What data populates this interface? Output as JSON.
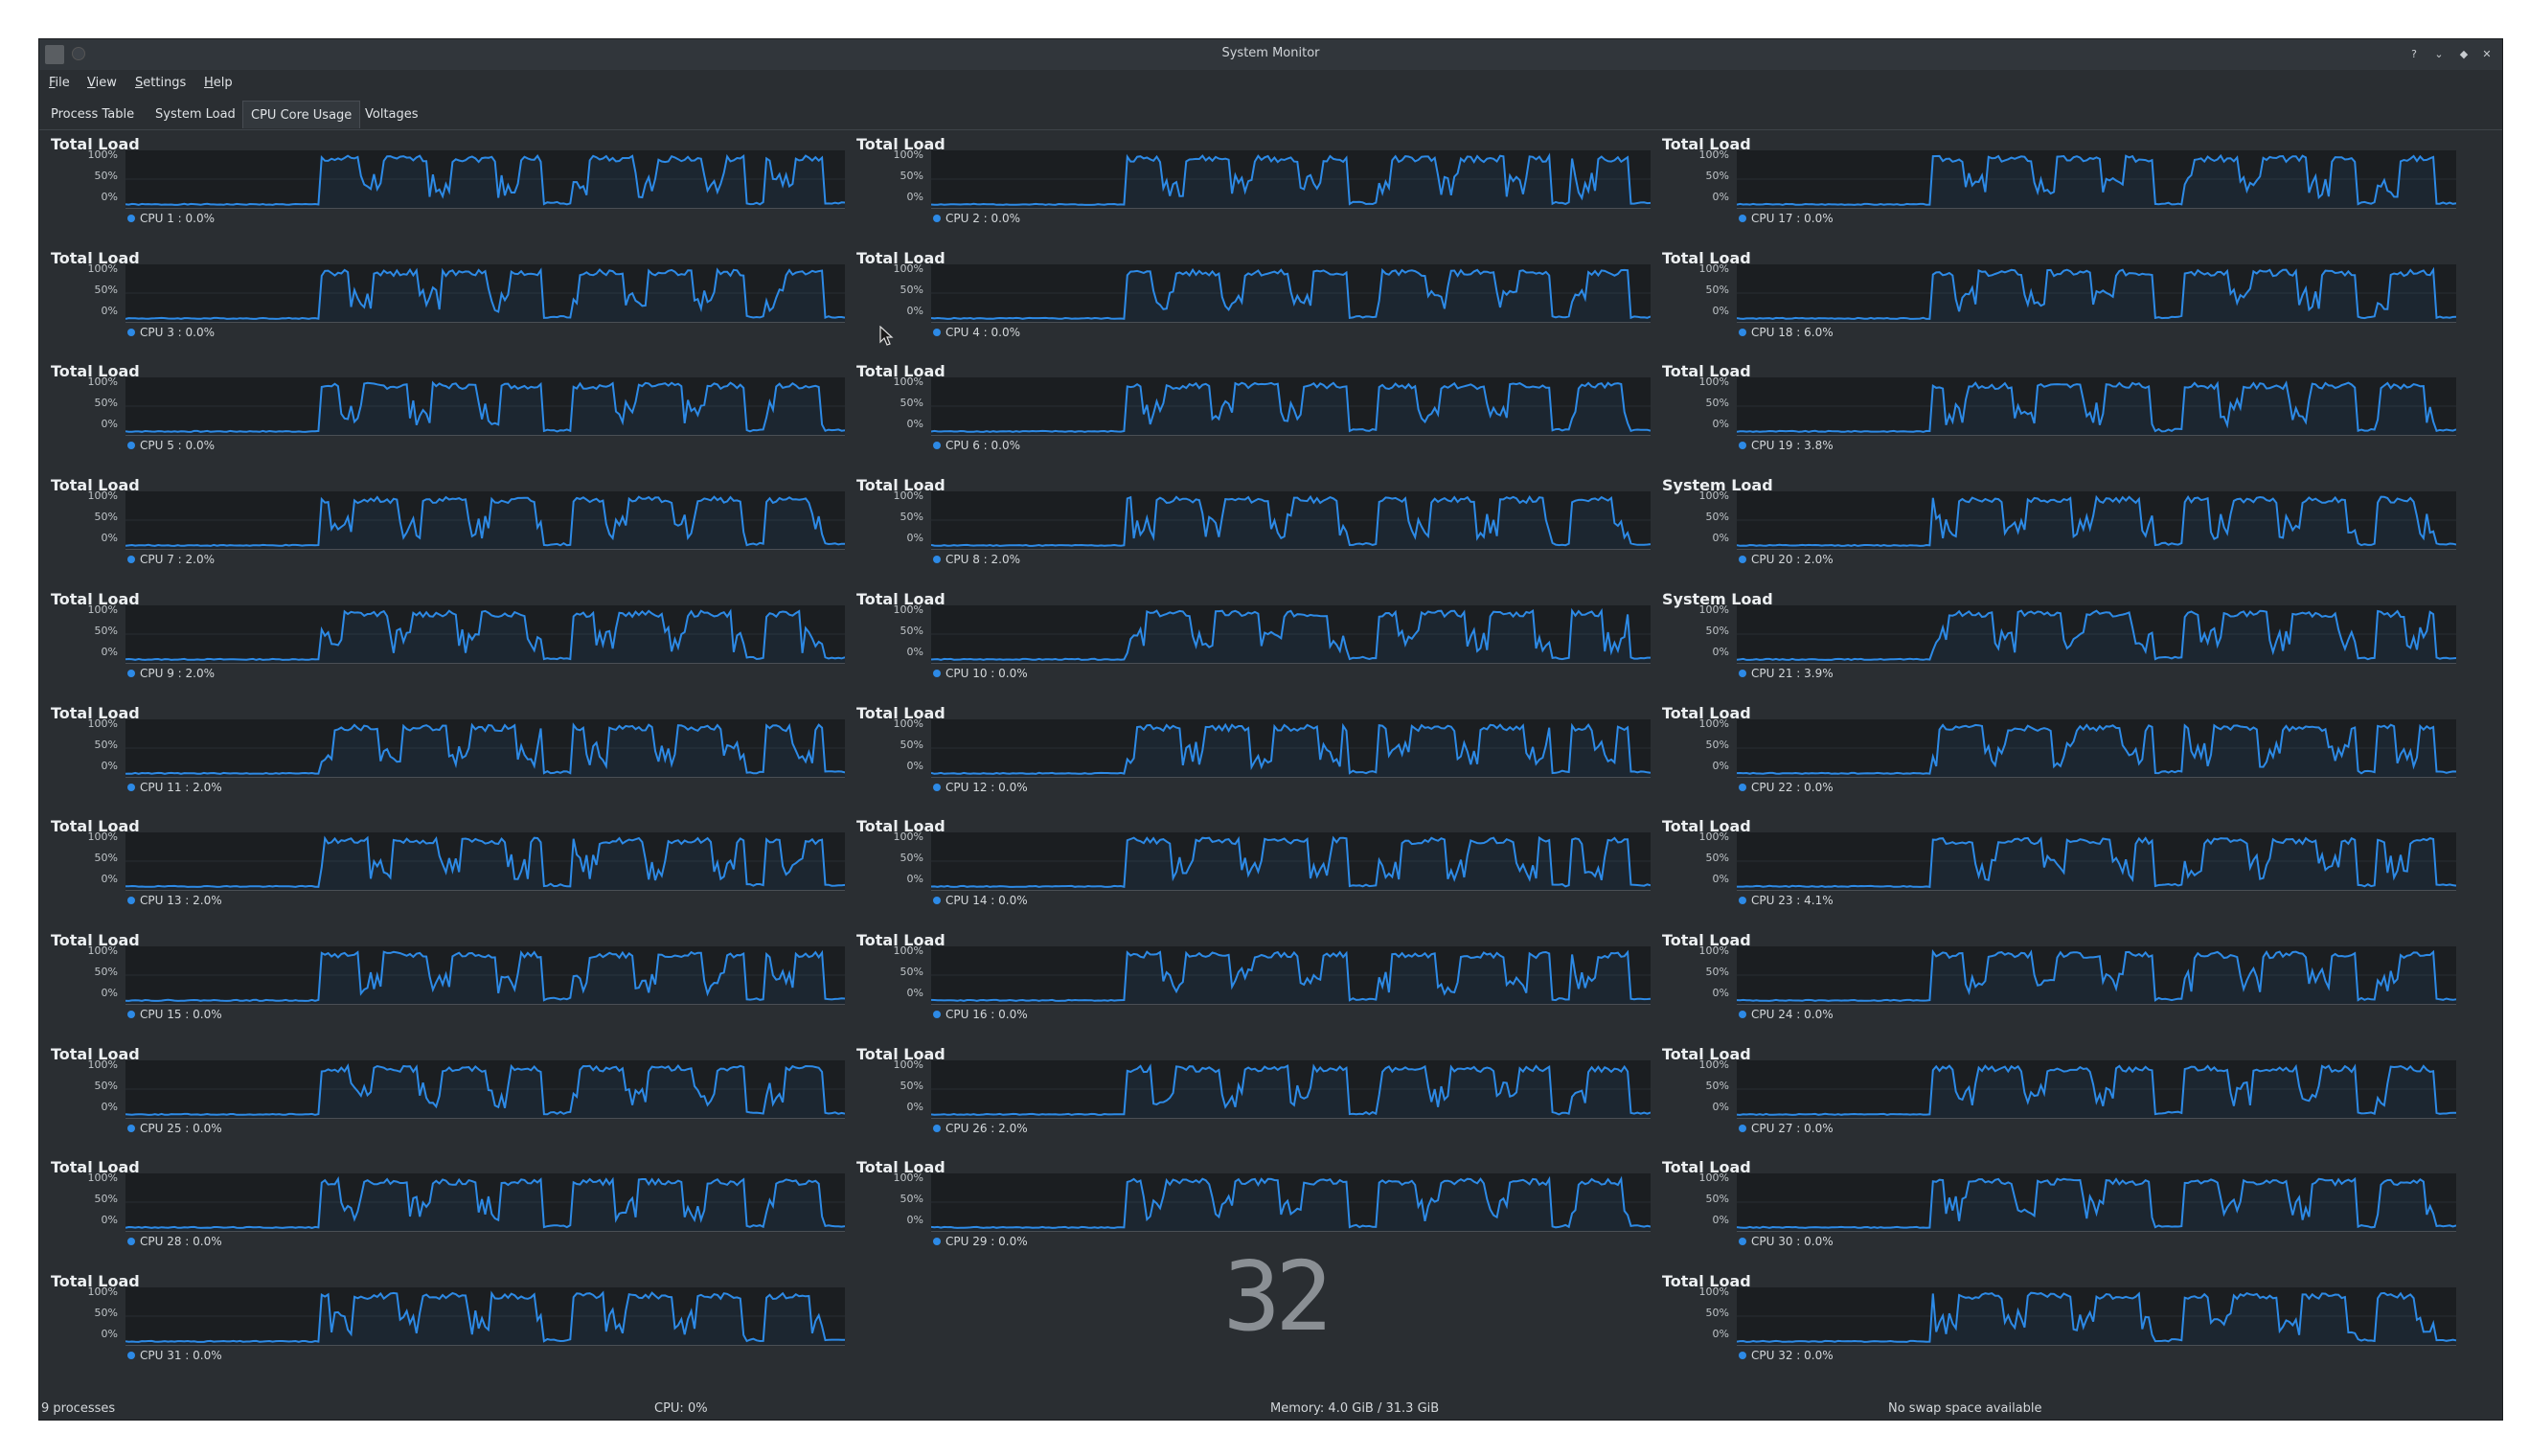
{
  "window": {
    "title": "System Monitor"
  },
  "menu": [
    "File",
    "View",
    "Settings",
    "Help"
  ],
  "tabs": [
    {
      "label": "Process Table",
      "active": false
    },
    {
      "label": "System Load",
      "active": false
    },
    {
      "label": "CPU Core Usage",
      "active": true
    },
    {
      "label": "Voltages",
      "active": false
    }
  ],
  "axis_labels": [
    "100%",
    "50%",
    "0%"
  ],
  "line_color": "#2d8ae6",
  "panels": [
    {
      "title": "Total Load",
      "legend": "CPU 1 : 0.0%"
    },
    {
      "title": "Total Load",
      "legend": "CPU 2 : 0.0%"
    },
    {
      "title": "Total Load",
      "legend": "CPU 17 : 0.0%"
    },
    {
      "title": "Total Load",
      "legend": "CPU 3 : 0.0%"
    },
    {
      "title": "Total Load",
      "legend": "CPU 4 : 0.0%"
    },
    {
      "title": "Total Load",
      "legend": "CPU 18 : 6.0%"
    },
    {
      "title": "Total Load",
      "legend": "CPU 5 : 0.0%"
    },
    {
      "title": "Total Load",
      "legend": "CPU 6 : 0.0%"
    },
    {
      "title": "Total Load",
      "legend": "CPU 19 : 3.8%"
    },
    {
      "title": "Total Load",
      "legend": "CPU 7 : 2.0%"
    },
    {
      "title": "Total Load",
      "legend": "CPU 8 : 2.0%"
    },
    {
      "title": "System Load",
      "legend": "CPU 20 : 2.0%"
    },
    {
      "title": "Total Load",
      "legend": "CPU 9 : 2.0%"
    },
    {
      "title": "Total Load",
      "legend": "CPU 10 : 0.0%"
    },
    {
      "title": "System Load",
      "legend": "CPU 21 : 3.9%"
    },
    {
      "title": "Total Load",
      "legend": "CPU 11 : 2.0%"
    },
    {
      "title": "Total Load",
      "legend": "CPU 12 : 0.0%"
    },
    {
      "title": "Total Load",
      "legend": "CPU 22 : 0.0%"
    },
    {
      "title": "Total Load",
      "legend": "CPU 13 : 2.0%"
    },
    {
      "title": "Total Load",
      "legend": "CPU 14 : 0.0%"
    },
    {
      "title": "Total Load",
      "legend": "CPU 23 : 4.1%"
    },
    {
      "title": "Total Load",
      "legend": "CPU 15 : 0.0%"
    },
    {
      "title": "Total Load",
      "legend": "CPU 16 : 0.0%"
    },
    {
      "title": "Total Load",
      "legend": "CPU 24 : 0.0%"
    },
    {
      "title": "Total Load",
      "legend": "CPU 25 : 0.0%"
    },
    {
      "title": "Total Load",
      "legend": "CPU 26 : 2.0%"
    },
    {
      "title": "Total Load",
      "legend": "CPU 27 : 0.0%"
    },
    {
      "title": "Total Load",
      "legend": "CPU 28 : 0.0%"
    },
    {
      "title": "Total Load",
      "legend": "CPU 29 : 0.0%"
    },
    {
      "title": "Total Load",
      "legend": "CPU 30 : 0.0%"
    },
    {
      "title": "Total Load",
      "legend": "CPU 31 : 0.0%"
    },
    null,
    {
      "title": "Total Load",
      "legend": "CPU 32 : 0.0%"
    }
  ],
  "big_number": "32",
  "status": {
    "processes": "9 processes",
    "cpu": "CPU: 0%",
    "memory": "Memory: 4.0 GiB / 31.3 GiB",
    "swap": "No swap space available"
  }
}
